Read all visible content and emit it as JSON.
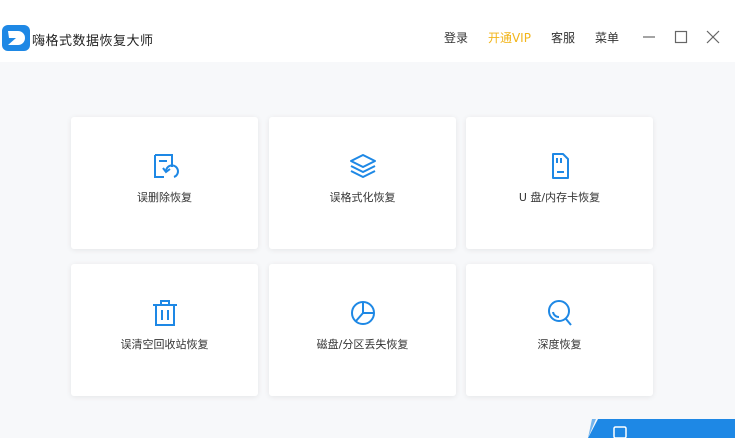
{
  "app": {
    "title": "嗨格式数据恢复大师"
  },
  "titlebar": {
    "login_label": "登录",
    "vip_label": "开通VIP",
    "service_label": "客服",
    "menu_label": "菜单"
  },
  "cards": [
    {
      "label": "误删除恢复",
      "icon": "file-undo-icon"
    },
    {
      "label": "误格式化恢复",
      "icon": "layers-icon"
    },
    {
      "label": "U 盘/内存卡恢复",
      "icon": "sd-card-icon"
    },
    {
      "label": "误清空回收站恢复",
      "icon": "trash-icon"
    },
    {
      "label": "磁盘/分区丢失恢复",
      "icon": "pie-chart-icon"
    },
    {
      "label": "深度恢复",
      "icon": "search-icon"
    }
  ],
  "colors": {
    "accent": "#1e88e5",
    "vip": "#f2b51a",
    "text": "#333333"
  }
}
